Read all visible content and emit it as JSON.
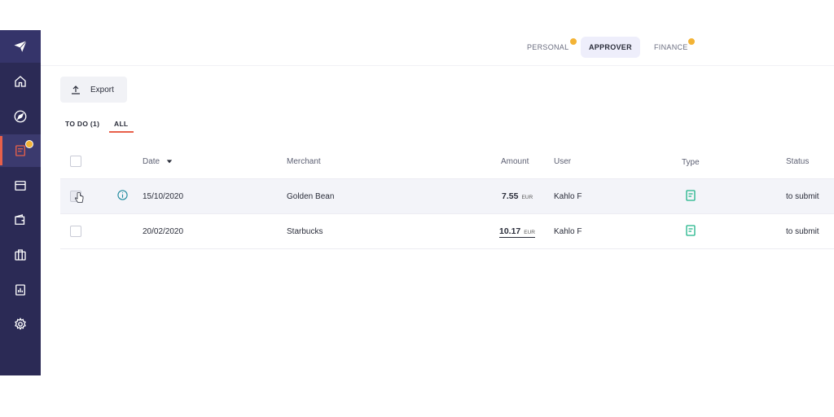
{
  "top_tabs": [
    {
      "label": "PERSONAL",
      "badge": true
    },
    {
      "label": "APPROVER",
      "badge": false,
      "active": true
    },
    {
      "label": "FINANCE",
      "badge": true
    }
  ],
  "toolbar": {
    "export_label": "Export"
  },
  "sub_tabs": [
    {
      "label": "TO DO (1)"
    },
    {
      "label": "ALL",
      "active": true
    }
  ],
  "table": {
    "columns": [
      "Date",
      "Merchant",
      "Amount",
      "User",
      "Type",
      "Status"
    ],
    "rows": [
      {
        "date": "15/10/2020",
        "merchant": "Golden Bean",
        "amount": "7.55",
        "currency": "EUR",
        "user": "Kahlo F",
        "type_icon": "receipt-icon",
        "status": "to submit"
      },
      {
        "date": "20/02/2020",
        "merchant": "Starbucks",
        "amount": "10.17",
        "currency": "EUR",
        "user": "Kahlo F",
        "type_icon": "receipt-icon",
        "status": "to submit"
      }
    ]
  },
  "sidebar": {
    "items": [
      "home-icon",
      "travel-icon",
      "expenses-icon",
      "cards-icon",
      "wallet-icon",
      "briefcase-icon",
      "reports-icon",
      "settings-icon"
    ],
    "active": "expenses-icon"
  },
  "colors": {
    "sidebar": "#2b2a55",
    "accent": "#e8604a",
    "badge": "#f3b335",
    "type_icon": "#1fb489"
  }
}
